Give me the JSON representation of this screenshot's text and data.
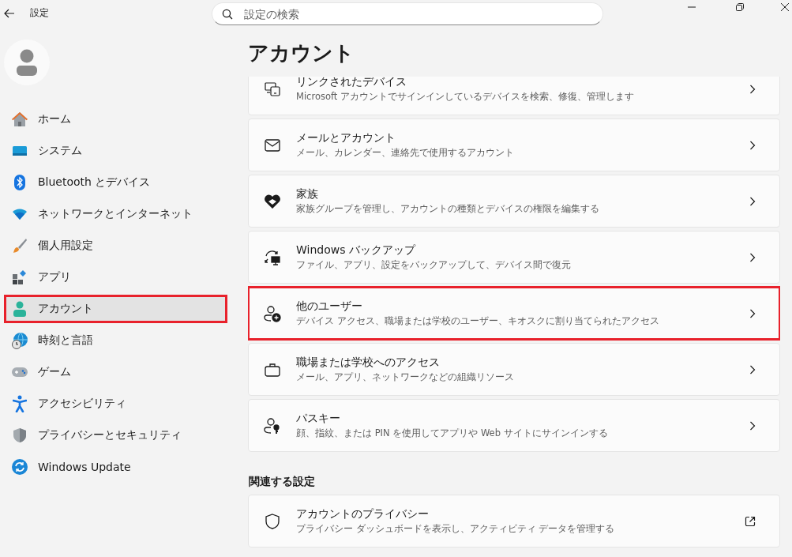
{
  "window": {
    "title": "設定"
  },
  "search": {
    "placeholder": "設定の検索"
  },
  "sidebar": {
    "items": [
      {
        "label": "ホーム",
        "kind": "home",
        "selected": false,
        "highlighted": false
      },
      {
        "label": "システム",
        "kind": "system",
        "selected": false,
        "highlighted": false
      },
      {
        "label": "Bluetooth とデバイス",
        "kind": "bluetooth",
        "selected": false,
        "highlighted": false
      },
      {
        "label": "ネットワークとインターネット",
        "kind": "wifi",
        "selected": false,
        "highlighted": false
      },
      {
        "label": "個人用設定",
        "kind": "brush",
        "selected": false,
        "highlighted": false
      },
      {
        "label": "アプリ",
        "kind": "apps",
        "selected": false,
        "highlighted": false
      },
      {
        "label": "アカウント",
        "kind": "person",
        "selected": true,
        "highlighted": true
      },
      {
        "label": "時刻と言語",
        "kind": "globe",
        "selected": false,
        "highlighted": false
      },
      {
        "label": "ゲーム",
        "kind": "gamepad",
        "selected": false,
        "highlighted": false
      },
      {
        "label": "アクセシビリティ",
        "kind": "accessibility",
        "selected": false,
        "highlighted": false
      },
      {
        "label": "プライバシーとセキュリティ",
        "kind": "shield",
        "selected": false,
        "highlighted": false
      },
      {
        "label": "Windows Update",
        "kind": "update",
        "selected": false,
        "highlighted": false
      }
    ]
  },
  "page": {
    "title": "アカウント",
    "cards": [
      {
        "title": "リンクされたデバイス",
        "description": "Microsoft アカウントでサインインしているデバイスを検索、修復、管理します",
        "kind": "devices",
        "external": false,
        "highlighted": false
      },
      {
        "title": "メールとアカウント",
        "description": "メール、カレンダー、連絡先で使用するアカウント",
        "kind": "mail",
        "external": false,
        "highlighted": false
      },
      {
        "title": "家族",
        "description": "家族グループを管理し、アカウントの種類とデバイスの権限を編集する",
        "kind": "family",
        "external": false,
        "highlighted": false
      },
      {
        "title": "Windows バックアップ",
        "description": "ファイル、アプリ、設定をバックアップして、デバイス間で復元",
        "kind": "backup",
        "external": false,
        "highlighted": false
      },
      {
        "title": "他のユーザー",
        "description": "デバイス アクセス、職場または学校のユーザー、キオスクに割り当てられたアクセス",
        "kind": "adduser",
        "external": false,
        "highlighted": true
      },
      {
        "title": "職場または学校へのアクセス",
        "description": "メール、アプリ、ネットワークなどの組織リソース",
        "kind": "briefcase",
        "external": false,
        "highlighted": false
      },
      {
        "title": "パスキー",
        "description": "顔、指紋、または PIN を使用してアプリや Web サイトにサインインする",
        "kind": "passkey",
        "external": false,
        "highlighted": false
      }
    ],
    "related": {
      "heading": "関連する設定",
      "cards": [
        {
          "title": "アカウントのプライバシー",
          "description": "プライバシー ダッシュボードを表示し、アクティビティ データを管理する",
          "kind": "shield-outline",
          "external": true,
          "highlighted": false
        }
      ]
    }
  }
}
